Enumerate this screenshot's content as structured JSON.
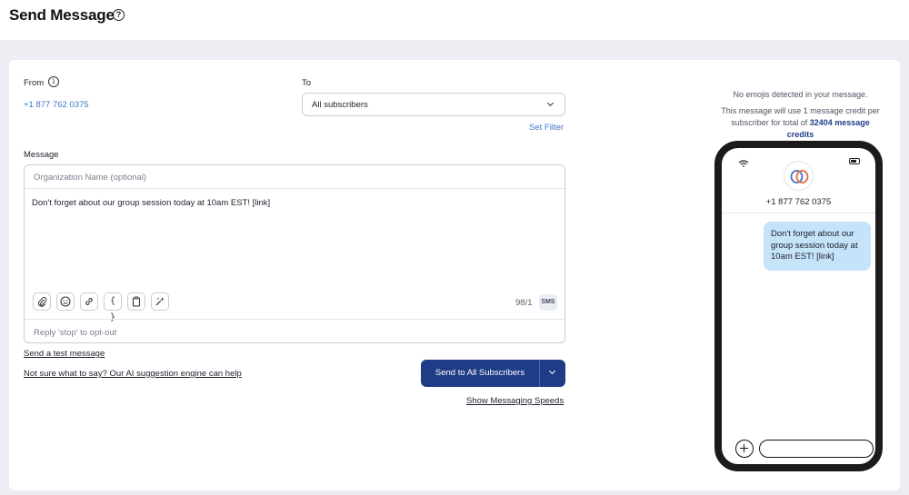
{
  "header": {
    "title": "Send Message",
    "help_glyph": "?"
  },
  "form": {
    "from_label": "From",
    "from_number": "+1 877 762 0375",
    "to_label": "To",
    "to_value": "All subscribers",
    "set_filter": "Set Filter",
    "message_label": "Message",
    "org_placeholder": "Organization Name (optional)",
    "message_text": "Don't forget about our group session today at 10am EST! [link]",
    "char_count": "98/1",
    "sms_badge": "SMS",
    "optout_text": "Reply 'stop' to opt-out",
    "tools": [
      "paperclip-icon",
      "emoji-icon",
      "link-icon",
      "variable-braces-icon",
      "clipboard-icon",
      "sparkle-ai-icon"
    ]
  },
  "links": {
    "test_message": "Send a test message",
    "ai_suggestion": "Not sure what to say? Our AI suggestion engine can help",
    "messaging_speeds": "Show Messaging Speeds"
  },
  "send_button": {
    "label": "Send to All Subscribers"
  },
  "preview": {
    "emoji_info": "No emojis detected in your message.",
    "credit_line1": "This message will use 1 message credit per",
    "credit_line2_prefix": "subscriber for total of",
    "credit_amount": "32404 message",
    "credit_suffix": "credits",
    "contact_number": "+1 877 762 0375",
    "bubble_text": "Don't forget about our group session today at 10am EST! [link]"
  },
  "colors": {
    "primary": "#1f3d86",
    "link": "#3a78c9",
    "bubble": "#c5e3f9"
  }
}
